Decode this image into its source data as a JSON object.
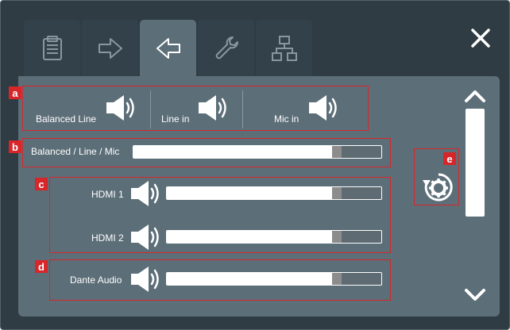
{
  "tabs": [
    {
      "id": "clipboard",
      "icon": "clipboard-icon",
      "active": false
    },
    {
      "id": "output",
      "icon": "arrow-right-outline-icon",
      "active": false
    },
    {
      "id": "input",
      "icon": "arrow-left-outline-icon",
      "active": true
    },
    {
      "id": "tools",
      "icon": "wrench-icon",
      "active": false
    },
    {
      "id": "network",
      "icon": "network-icon",
      "active": false
    }
  ],
  "tags": {
    "a": "a",
    "b": "b",
    "c": "c",
    "d": "d",
    "e": "e"
  },
  "input_sources": [
    {
      "label": "Balanced Line",
      "icon": "speaker-icon"
    },
    {
      "label": "Line in",
      "icon": "speaker-icon"
    },
    {
      "label": "Mic in",
      "icon": "speaker-icon"
    }
  ],
  "master": {
    "label": "Balanced / Line / Mic",
    "level": 0.8
  },
  "hdmi": [
    {
      "label": "HDMI 1",
      "icon": "speaker-icon",
      "level": 0.77
    },
    {
      "label": "HDMI 2",
      "icon": "speaker-icon",
      "level": 0.77
    }
  ],
  "dante": {
    "label": "Dante Audio",
    "icon": "speaker-icon",
    "level": 0.77
  },
  "controls": {
    "close_icon": "close-icon",
    "reset_icon": "reset-settings-icon",
    "scroll_up_icon": "chevron-up-icon",
    "scroll_down_icon": "chevron-down-icon"
  },
  "colors": {
    "frame_bg": "#2f3c43",
    "panel_bg": "#5c6e78",
    "active_tab": "#5c6e78",
    "highlight": "#d7262a",
    "bar_fill": "#ffffff",
    "bar_thumb": "#8c8c8c"
  }
}
